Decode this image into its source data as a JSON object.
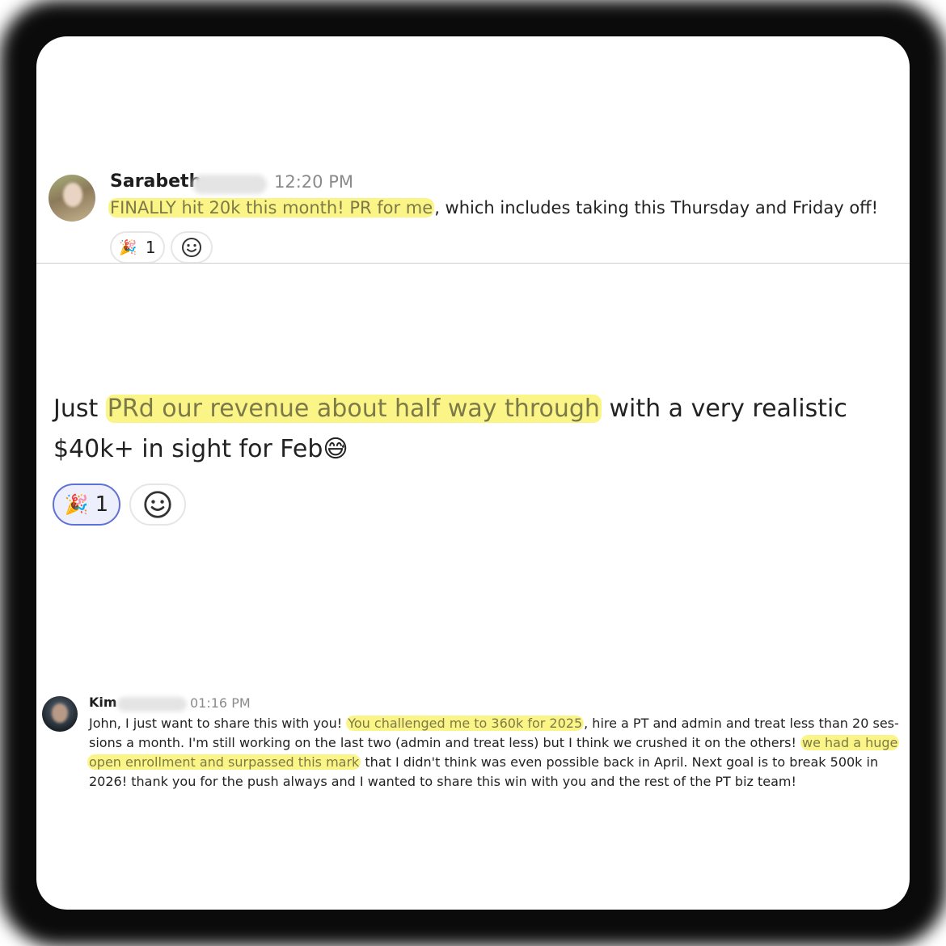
{
  "posts": [
    {
      "author_name": "Sarabeth",
      "timestamp": "12:20 PM",
      "message_highlighted": "FINALLY hit 20k this month! PR for me",
      "message_rest": ", which includes taking this Thursday and Friday off!",
      "reaction": {
        "icon": "party-popper-icon",
        "glyph": "🎉",
        "count": "1"
      },
      "add_reaction_icon": "smiley-icon"
    },
    {
      "message_line1_prefix": "Just ",
      "message_line1_highlighted": "PRd our revenue about half way through",
      "message_line1_suffix": " with a very realistic",
      "message_line2": "$40k+ in sight for Feb",
      "message_emoji": "😅",
      "reaction": {
        "icon": "party-popper-icon",
        "glyph": "🎉",
        "count": "1"
      },
      "add_reaction_icon": "smiley-icon"
    },
    {
      "author_name": "Kim",
      "timestamp": "01:16 PM",
      "line1_prefix": "John, I just want to share this with you! ",
      "line1_highlighted": "You challenged me to 360k for 2025",
      "line1_suffix": ", hire a PT and admin and treat less than 20 ses-",
      "line2_prefix": "sions a month. I'm still working on the last two (admin and treat less) but I think we crushed it on the others! ",
      "line2_highlighted": "we had a huge",
      "line3_highlighted": "open enrollment and surpassed this mark",
      "line3_suffix": " that I didn't think was even possible back in April. Next goal is to break 500k in",
      "line4": "2026! thank you for the push always and I wanted to share this win with you and the rest of the PT biz team!"
    }
  ],
  "colors": {
    "highlight": "#fbf587",
    "selected_reaction_border": "#5f72d4"
  }
}
